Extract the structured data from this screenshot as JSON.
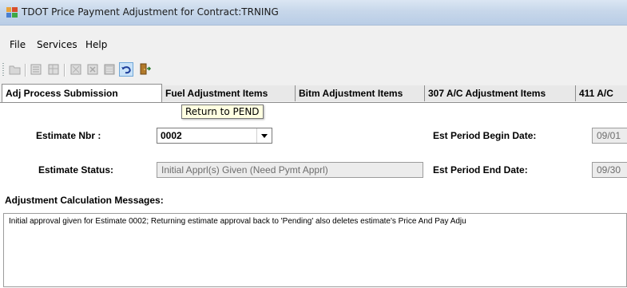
{
  "window": {
    "title": "TDOT Price Payment Adjustment for Contract:TRNING",
    "icon": "app-window-icon"
  },
  "menu": {
    "items": [
      "File",
      "Services",
      "Help"
    ]
  },
  "toolbar": {
    "buttons": [
      {
        "name": "open-folder-icon",
        "enabled": false
      },
      {
        "name": "document-list-icon",
        "enabled": false
      },
      {
        "name": "grid-icon",
        "enabled": false
      },
      {
        "name": "calc-sheet-icon",
        "enabled": false
      },
      {
        "name": "delete-sheet-icon",
        "enabled": false
      },
      {
        "name": "calculator-icon",
        "enabled": false
      },
      {
        "name": "undo-return-icon",
        "enabled": true
      },
      {
        "name": "exit-door-icon",
        "enabled": true
      }
    ],
    "tooltip": "Return to PEND"
  },
  "tabs": [
    "Adj Process Submission",
    "Fuel Adjustment Items",
    "Bitm Adjustment Items",
    "307 A/C Adjustment Items",
    "411 A/C"
  ],
  "form": {
    "estimate_nbr_label": "Estimate Nbr :",
    "estimate_nbr_value": "0002",
    "estimate_status_label": "Estimate Status:",
    "estimate_status_value": "Initial Apprl(s) Given (Need Pymt Apprl)",
    "begin_date_label": "Est Period Begin Date:",
    "begin_date_value": "09/01",
    "end_date_label": "Est Period End Date:",
    "end_date_value": "09/30"
  },
  "messages": {
    "header": "Adjustment Calculation Messages:",
    "text": "Initial approval given for Estimate 0002; Returning estimate approval back to 'Pending' also deletes estimate's Price And Pay Adju"
  },
  "colors": {
    "title_bar": "#c7d7ea",
    "tooltip_bg": "#ffffe1",
    "panel_bg": "#ffffff"
  }
}
